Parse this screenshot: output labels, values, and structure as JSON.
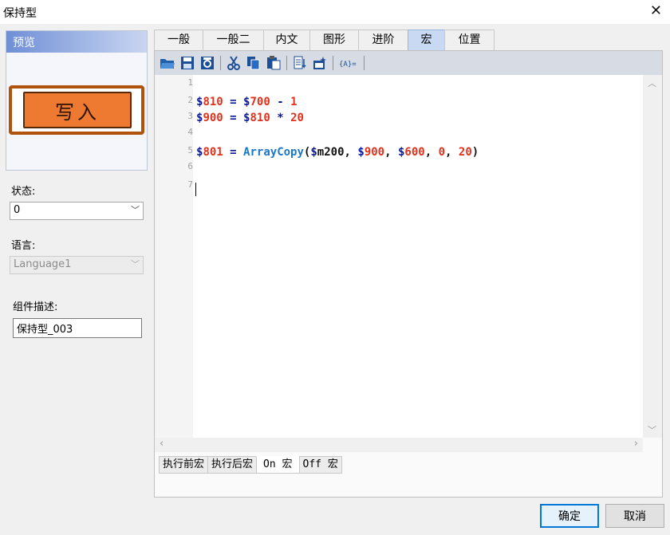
{
  "window": {
    "title": "保持型",
    "close_glyph": "✕"
  },
  "preview": {
    "header": "预览",
    "button_text": "写入"
  },
  "state": {
    "label": "状态:",
    "value": "0"
  },
  "language": {
    "label": "语言:",
    "value": "Language1"
  },
  "description": {
    "label": "组件描述:",
    "value": "保持型_003"
  },
  "tabs": [
    {
      "label": "一般"
    },
    {
      "label": "一般二"
    },
    {
      "label": "内文"
    },
    {
      "label": "图形"
    },
    {
      "label": "进阶"
    },
    {
      "label": "宏",
      "active": true
    },
    {
      "label": "位置"
    }
  ],
  "toolbar_icons": [
    "open-folder-icon",
    "save-icon",
    "save-reload-icon",
    "cut-icon",
    "copy-icon",
    "paste-icon",
    "compile-icon",
    "build-icon",
    "variable-icon"
  ],
  "editor": {
    "line_numbers": [
      "1",
      "2",
      "3",
      "4",
      "5",
      "6",
      "7"
    ],
    "lines": [
      "",
      "$810 = $700 - 1",
      "$900 = $810 * 20",
      "",
      "$801 = ArrayCopy($m200, $900, $600, 0, 20)",
      "",
      ""
    ]
  },
  "macro_tabs": [
    {
      "label": "执行前宏"
    },
    {
      "label": "执行后宏"
    },
    {
      "label": "On 宏",
      "active": true
    },
    {
      "label": "Off 宏"
    }
  ],
  "buttons": {
    "ok": "确定",
    "cancel": "取消"
  },
  "colors": {
    "accent": "#0078d7",
    "active_tab": "#c8daf3",
    "keyword_red": "#e0311d",
    "function_blue": "#1b77c8"
  }
}
